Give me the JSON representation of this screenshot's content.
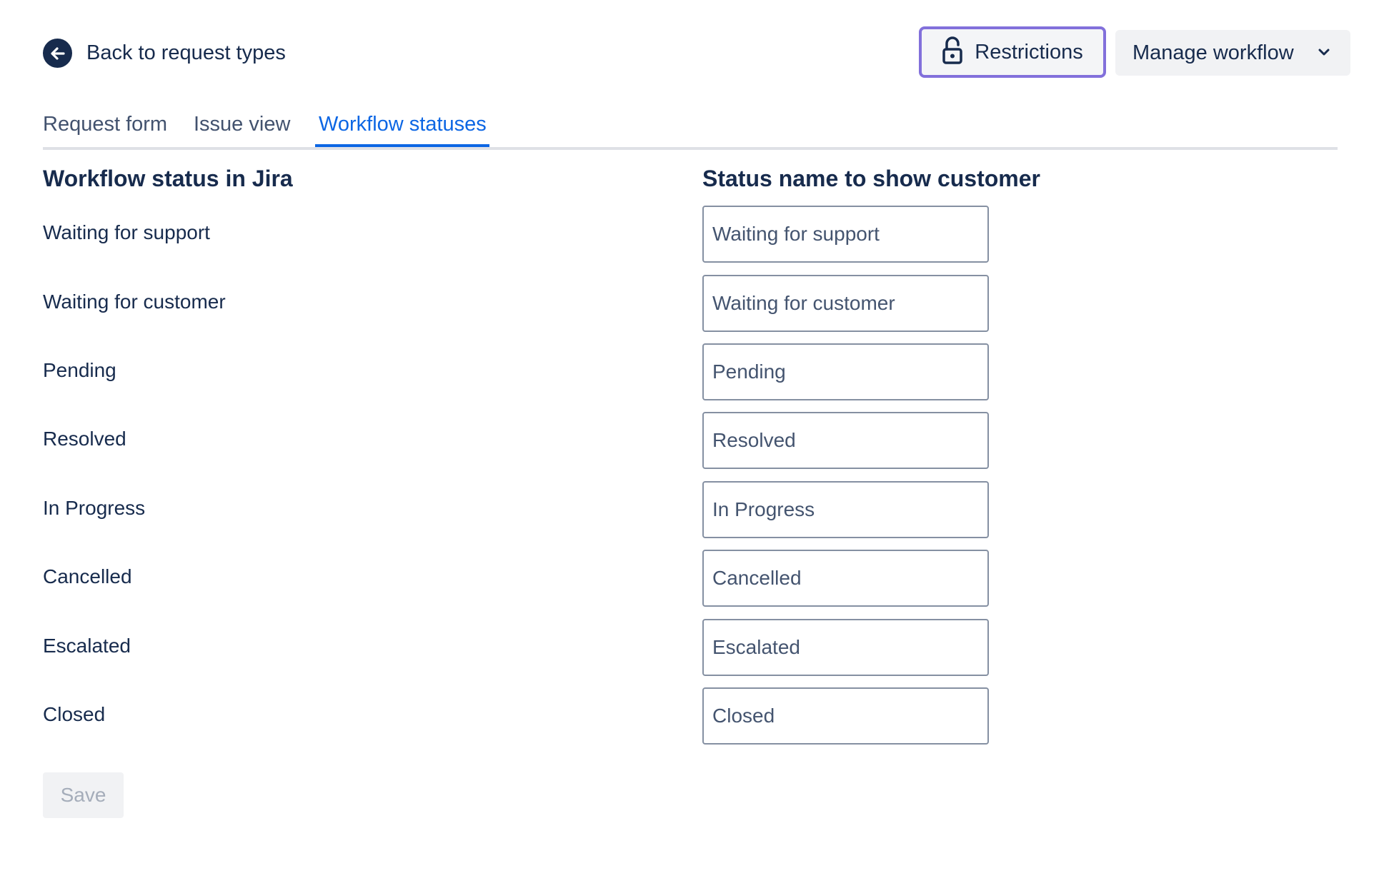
{
  "header": {
    "back_label": "Back to request types",
    "restrictions_label": "Restrictions",
    "manage_workflow_label": "Manage workflow"
  },
  "tabs": [
    {
      "label": "Request form",
      "active": false
    },
    {
      "label": "Issue view",
      "active": false
    },
    {
      "label": "Workflow statuses",
      "active": true
    }
  ],
  "columns": {
    "left_heading": "Workflow status in Jira",
    "right_heading": "Status name to show customer"
  },
  "statuses": [
    {
      "jira_status": "Waiting for support",
      "customer_name": "Waiting for support"
    },
    {
      "jira_status": "Waiting for customer",
      "customer_name": "Waiting for customer"
    },
    {
      "jira_status": "Pending",
      "customer_name": "Pending"
    },
    {
      "jira_status": "Resolved",
      "customer_name": "Resolved"
    },
    {
      "jira_status": "In Progress",
      "customer_name": "In Progress"
    },
    {
      "jira_status": "Cancelled",
      "customer_name": "Cancelled"
    },
    {
      "jira_status": "Escalated",
      "customer_name": "Escalated"
    },
    {
      "jira_status": "Closed",
      "customer_name": "Closed"
    }
  ],
  "save_label": "Save",
  "colors": {
    "text_primary": "#172b4d",
    "tab_active": "#0c66e4",
    "focus_ring": "#8270db",
    "button_bg": "#f1f2f4",
    "disabled_text": "#a5adba"
  },
  "icons": {
    "back": "arrow-left-circle-icon",
    "restrictions": "unlock-icon",
    "manage_workflow": "chevron-down-icon"
  }
}
